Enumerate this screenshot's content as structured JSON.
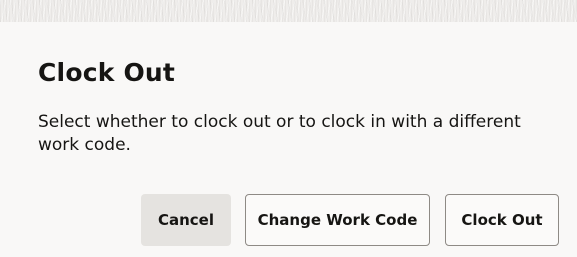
{
  "dialog": {
    "title": "Clock Out",
    "message": "Select whether to clock out or to clock in with a different work code."
  },
  "actions": {
    "cancel_label": "Cancel",
    "change_work_code_label": "Change Work Code",
    "clock_out_label": "Clock Out"
  },
  "colors": {
    "background": "#f9f8f7",
    "text": "#161513",
    "cancel_fill": "#e5e3e0",
    "outline_border": "#8e8a85"
  }
}
